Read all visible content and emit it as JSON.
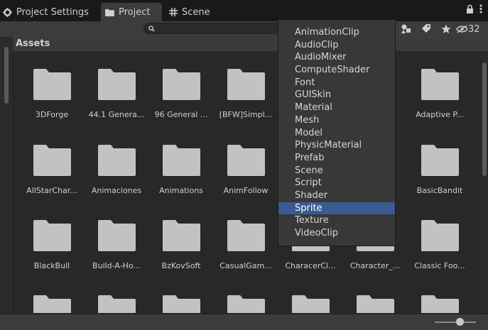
{
  "tabs": [
    {
      "label": "Project Settings",
      "icon": "gear-icon",
      "active": false
    },
    {
      "label": "Project",
      "icon": "folder-icon",
      "active": true
    },
    {
      "label": "Scene",
      "icon": "grid-icon",
      "active": false
    }
  ],
  "toolbar": {
    "search_placeholder": "",
    "hidden_count": "32"
  },
  "assets": {
    "header": "Assets",
    "items": [
      [
        "3DForge",
        "44.1 Genera...",
        "96 General ...",
        "[BFW]Simpl...",
        "",
        "",
        "Adaptive P..."
      ],
      [
        "AllStarChar...",
        "Animaciones",
        "Animations",
        "AnimFollow",
        "",
        "",
        "BasicBandit"
      ],
      [
        "BlackBull",
        "Build-A-Ho...",
        "BzKovSoft",
        "CasualGam...",
        "CharacerCl...",
        "Character_...",
        "Classic Foo..."
      ],
      [
        "",
        "",
        "",
        "",
        "",
        "",
        ""
      ]
    ]
  },
  "type_filter_menu": {
    "items": [
      "AnimationClip",
      "AudioClip",
      "AudioMixer",
      "ComputeShader",
      "Font",
      "GUISkin",
      "Material",
      "Mesh",
      "Model",
      "PhysicMaterial",
      "Prefab",
      "Scene",
      "Script",
      "Shader",
      "Sprite",
      "Texture",
      "VideoClip"
    ],
    "selected": "Sprite"
  },
  "colors": {
    "background": "#282828",
    "folder": "#c2c2c2",
    "selection": "#3a5b91"
  }
}
